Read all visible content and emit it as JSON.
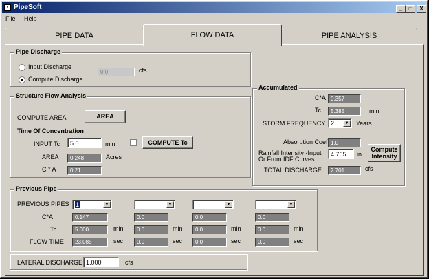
{
  "window": {
    "title": "PipeSoft",
    "min": "_",
    "max": "□",
    "close": "X"
  },
  "menu": [
    "File",
    "Help"
  ],
  "tabs": [
    "PIPE DATA",
    "FLOW DATA",
    "PIPE ANALYSIS"
  ],
  "active_tab": "FLOW DATA",
  "pipe_discharge": {
    "title": "Pipe Discharge",
    "input_label": "Input Discharge",
    "compute_label": "Compute Discharge",
    "selected": "Compute Discharge",
    "value": "0.0",
    "unit": "cfs"
  },
  "structure_flow": {
    "title": "Structure Flow Analysis",
    "compute_area_label": "COMPUTE AREA",
    "area_button": "AREA",
    "toc_label": "Time Of Concentration",
    "input_tc_label": "INPUT Tc",
    "input_tc_value": "5.0",
    "input_tc_unit": "min",
    "compute_tc_button": "COMPUTE Tc",
    "area_label": "AREA",
    "area_value": "0.248",
    "area_unit": "Acres",
    "ca_label": "C * A",
    "ca_value": "0.21"
  },
  "accumulated": {
    "title": "Accumulated",
    "ca_label": "C*A",
    "ca_value": "0.357",
    "tc_label": "Tc",
    "tc_value": "5.385",
    "tc_unit": "min",
    "storm_label": "STORM FREQUENCY",
    "storm_value": "2",
    "storm_unit": "Years",
    "absorption_label": "Absorption Coeff",
    "absorption_value": "1.0",
    "rainfall_label_1": "Rainfall Intensity -Input",
    "rainfall_label_2": "Or From IDF Curves",
    "rainfall_value": "4.765",
    "rainfall_unit": "in",
    "compute_intensity_1": "Compute",
    "compute_intensity_2": "Intensity",
    "total_label": "TOTAL DISCHARGE",
    "total_value": "2.701",
    "total_unit": "cfs"
  },
  "previous_pipe": {
    "title": "Previous Pipe",
    "pipes_label": "PREVIOUS PIPES",
    "ca_label": "C*A",
    "tc_label": "Tc",
    "flow_label": "FLOW TIME",
    "tc_unit": "min",
    "flow_unit": "sec",
    "columns": [
      {
        "pipe": "1",
        "ca": "0.147",
        "tc": "5.000",
        "flow": "23.085"
      },
      {
        "pipe": "",
        "ca": "0.0",
        "tc": "0.0",
        "flow": "0.0"
      },
      {
        "pipe": "",
        "ca": "0.0",
        "tc": "0.0",
        "flow": "0.0"
      },
      {
        "pipe": "",
        "ca": "0.0",
        "tc": "0.0",
        "flow": "0.0"
      }
    ]
  },
  "lateral": {
    "label": "LATERAL DISCHARGE",
    "value": "1.000",
    "unit": "cfs"
  }
}
